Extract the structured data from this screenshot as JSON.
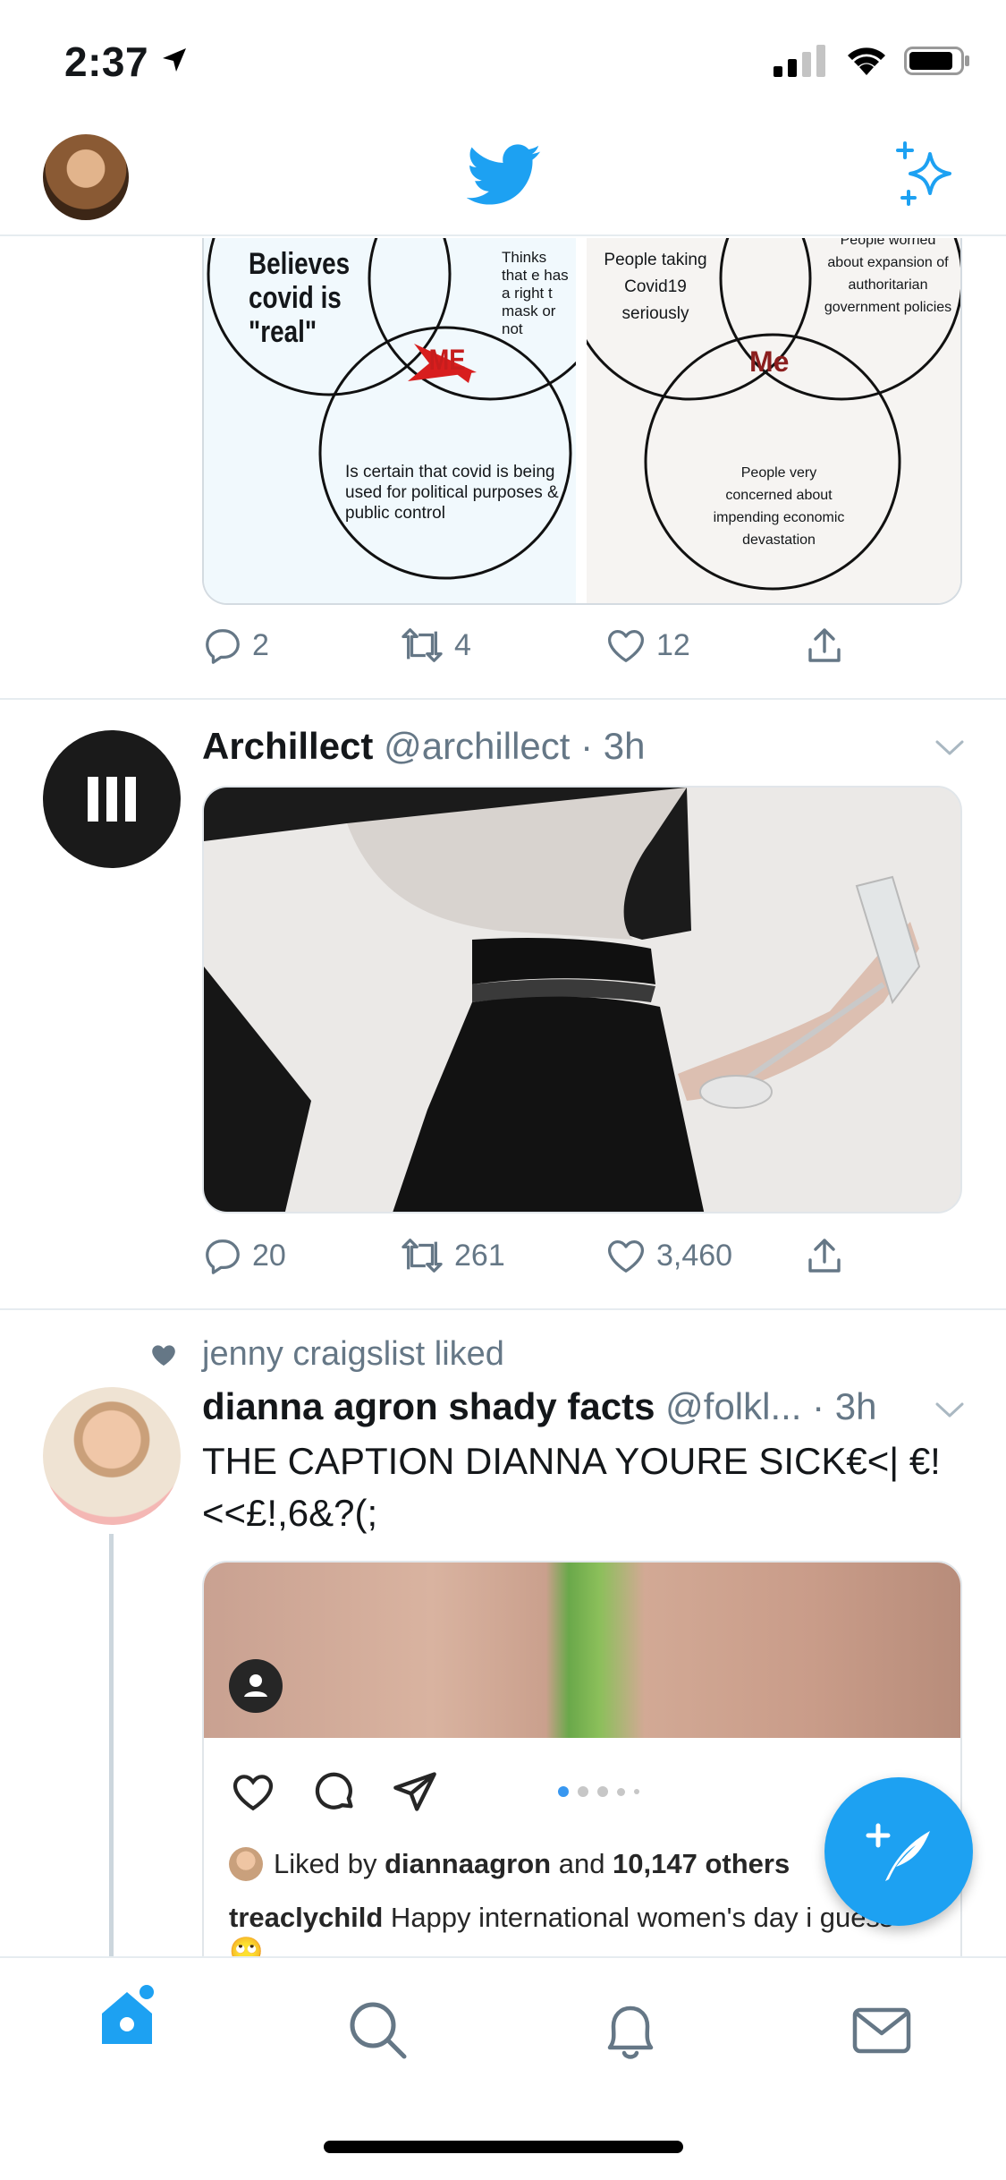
{
  "status_bar": {
    "time": "2:37"
  },
  "header": {
    "title_icon": "twitter-bird-icon",
    "right_icon": "sparkle-icon"
  },
  "tweet1": {
    "venn_left": {
      "label_a": "Believes covid is \"real\"",
      "label_b": "Thinks that everyone has a right to wear a mask or not",
      "label_b_visible": "Thinks that e has a right t mask or not",
      "label_c": "Is certain that covid is being used for political purposes & public control",
      "center": "ME"
    },
    "venn_right": {
      "label_a": "People taking Covid19 seriously",
      "label_b": "People worried about expansion of authoritarian government policies",
      "label_c": "People very concerned about impending economic devastation",
      "center": "Me"
    },
    "replies": "2",
    "retweets": "4",
    "likes": "12"
  },
  "tweet2": {
    "name": "Archillect",
    "handle": "@archillect",
    "time": "· 3h",
    "replies": "20",
    "retweets": "261",
    "likes": "3,460"
  },
  "tweet3": {
    "liked_by": "jenny craigslist liked",
    "name": "dianna agron shady facts",
    "handle": "@folkl...",
    "time": "· 3h",
    "text": "THE CAPTION DIANNA YOURE SICK€<| €!<<£!,6&?(;",
    "insta": {
      "liked_prefix": "Liked by ",
      "liked_user": "diannaagron",
      "liked_and": " and ",
      "liked_others": "10,147 others",
      "caption_user": "treaclychild",
      "caption_text": " Happy international women's day i guess 🙄"
    }
  },
  "tab_bar": {
    "items": [
      "home-icon",
      "search-icon",
      "notifications-icon",
      "messages-icon"
    ],
    "active": "home-icon"
  },
  "colors": {
    "accent": "#1da1f2",
    "muted": "#657786"
  }
}
